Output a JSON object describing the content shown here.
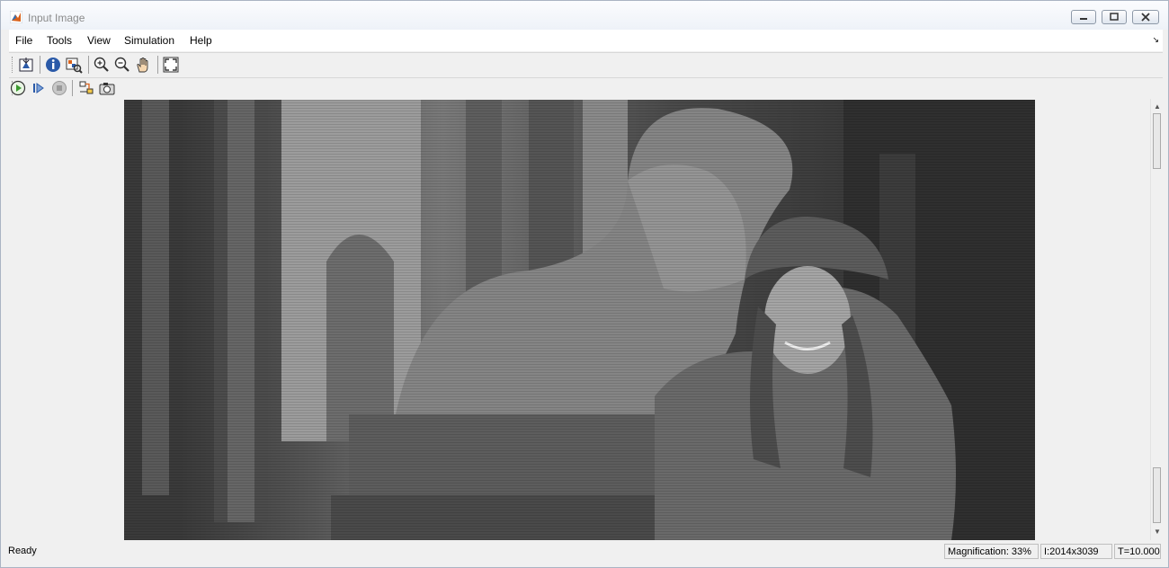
{
  "window": {
    "title": "Input Image"
  },
  "menu": {
    "items": [
      {
        "label": "File"
      },
      {
        "label": "Tools"
      },
      {
        "label": "View"
      },
      {
        "label": "Simulation"
      },
      {
        "label": "Help"
      }
    ]
  },
  "toolbar": {
    "buttons": [
      "export-to-workspace-icon",
      "image-info-icon",
      "pixel-region-icon",
      "zoom-in-icon",
      "zoom-out-icon",
      "pan-hand-icon",
      "fit-to-window-icon"
    ]
  },
  "sim_toolbar": {
    "buttons": [
      "run-icon",
      "step-forward-icon",
      "stop-icon",
      "highlight-block-icon",
      "snapshot-camera-icon"
    ]
  },
  "status": {
    "message": "Ready",
    "magnification": "Magnification: 33%",
    "dimensions": "I:2014x3039",
    "time": "T=10.000"
  },
  "colors": {
    "run_green": "#3a9a2e",
    "info_blue": "#2b5aa8"
  }
}
